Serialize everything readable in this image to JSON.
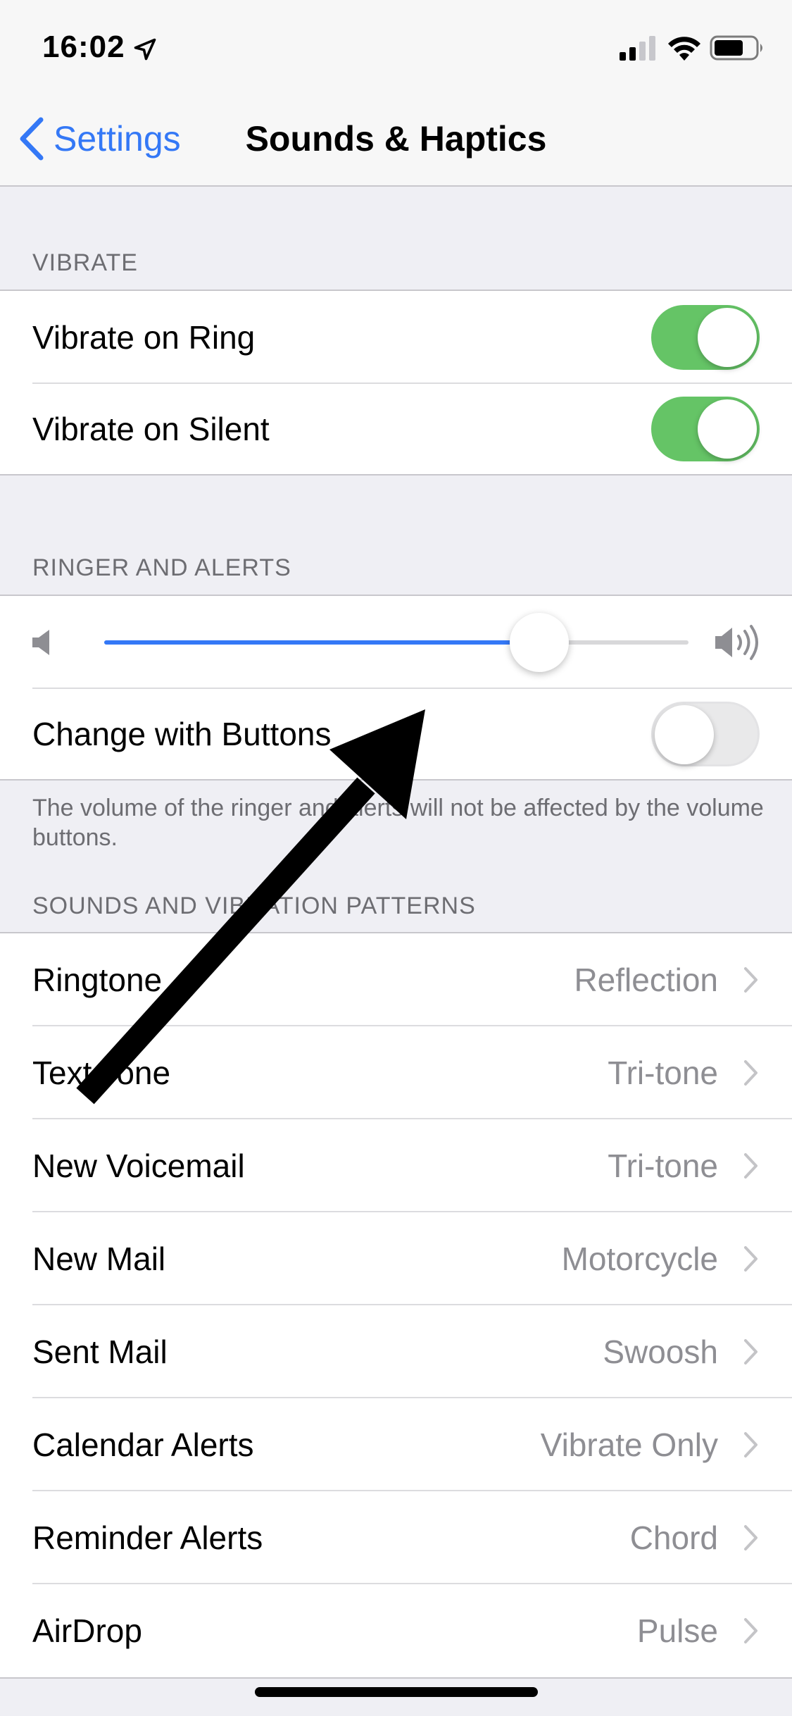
{
  "status_bar": {
    "time": "16:02"
  },
  "nav": {
    "back_label": "Settings",
    "title": "Sounds & Haptics"
  },
  "vibrate": {
    "header": "VIBRATE",
    "rows": [
      {
        "label": "Vibrate on Ring",
        "on": true
      },
      {
        "label": "Vibrate on Silent",
        "on": true
      }
    ]
  },
  "ringer": {
    "header": "RINGER AND ALERTS",
    "volume_fraction": 0.745,
    "change_with_buttons_label": "Change with Buttons",
    "change_with_buttons_on": false,
    "footer": "The volume of the ringer and alerts will not be affected by the volume buttons."
  },
  "patterns": {
    "header": "SOUNDS AND VIBRATION PATTERNS",
    "rows": [
      {
        "label": "Ringtone",
        "value": "Reflection"
      },
      {
        "label": "Text Tone",
        "value": "Tri-tone"
      },
      {
        "label": "New Voicemail",
        "value": "Tri-tone"
      },
      {
        "label": "New Mail",
        "value": "Motorcycle"
      },
      {
        "label": "Sent Mail",
        "value": "Swoosh"
      },
      {
        "label": "Calendar Alerts",
        "value": "Vibrate Only"
      },
      {
        "label": "Reminder Alerts",
        "value": "Chord"
      },
      {
        "label": "AirDrop",
        "value": "Pulse"
      }
    ]
  },
  "colors": {
    "accent": "#3478f6",
    "toggle_on": "#65c466"
  },
  "icons": {
    "location": "location-arrow-icon",
    "signal": "cellular-signal-icon",
    "wifi": "wifi-icon",
    "battery": "battery-icon",
    "back": "chevron-left-icon",
    "volume_low": "speaker-low-icon",
    "volume_high": "speaker-high-icon",
    "row_chevron": "chevron-right-icon",
    "annotation": "annotation-arrow-icon"
  }
}
